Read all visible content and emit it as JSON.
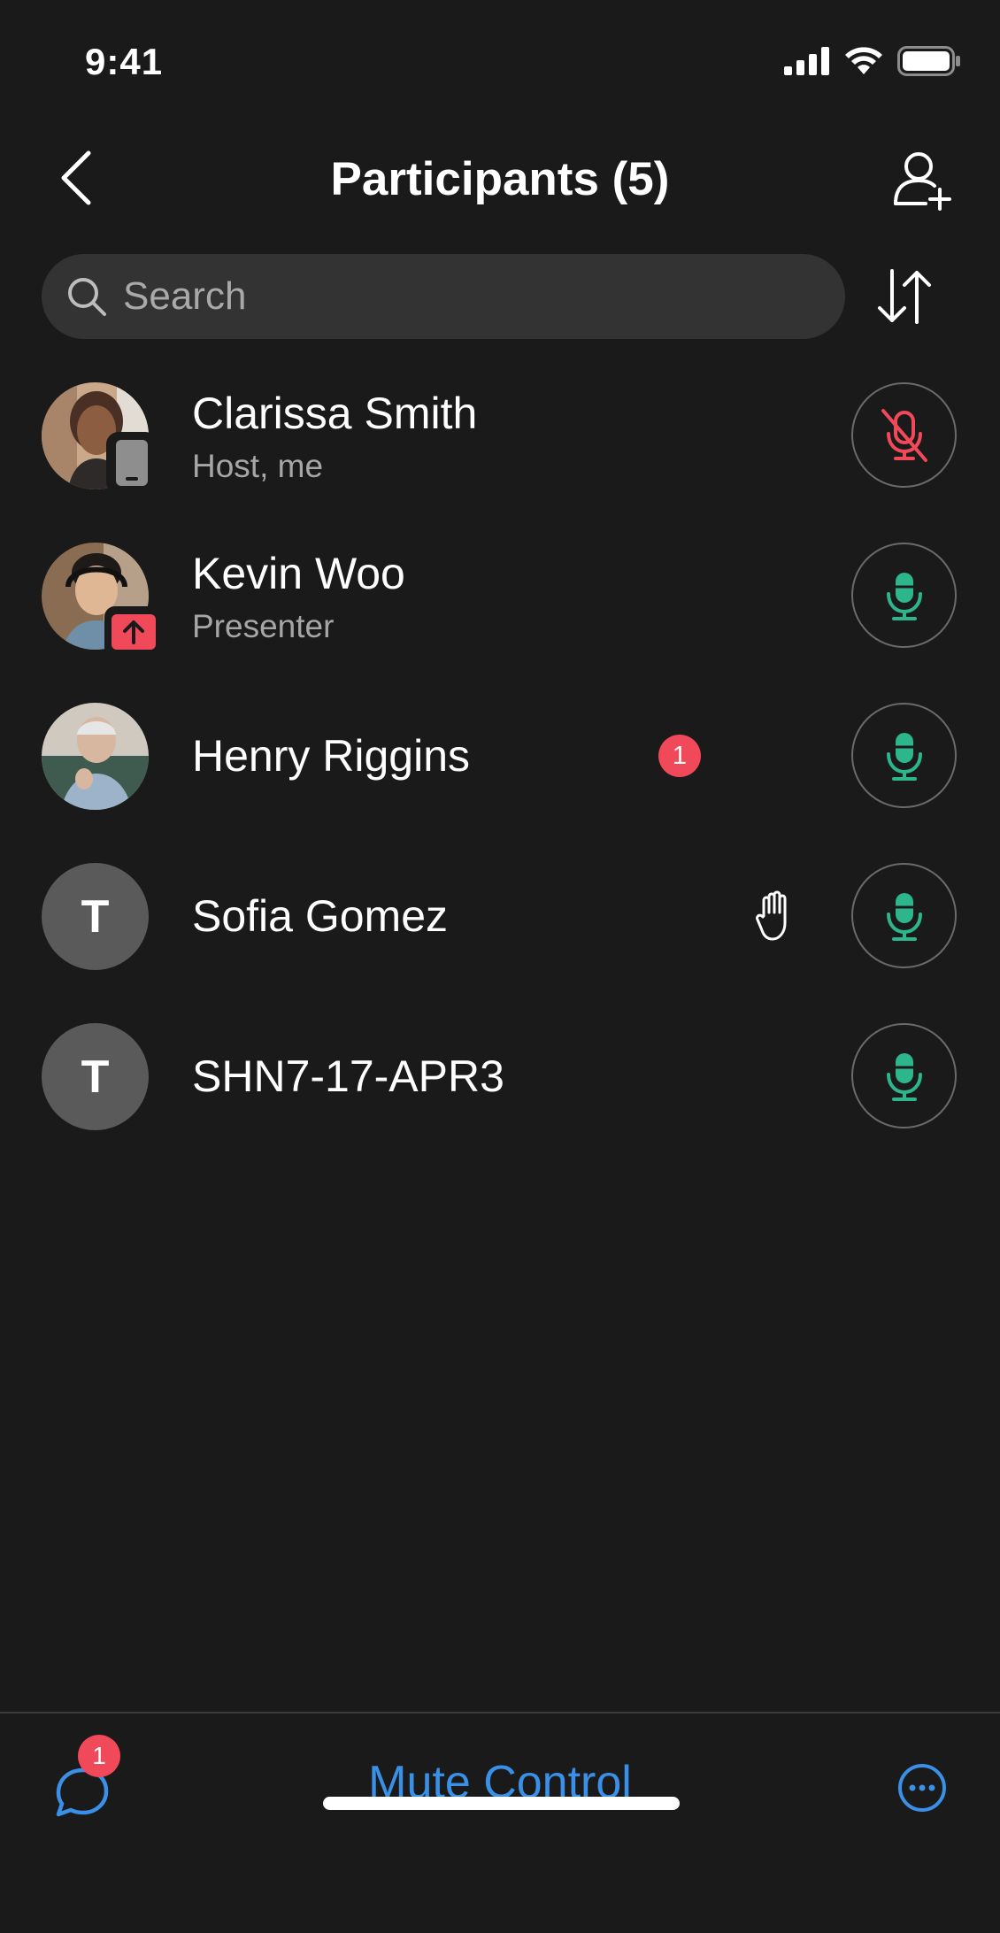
{
  "status_bar": {
    "time": "9:41"
  },
  "header": {
    "title": "Participants (5)"
  },
  "search": {
    "placeholder": "Search"
  },
  "participants": [
    {
      "name": "Clarissa Smith",
      "role": "Host, me",
      "avatar": "photo",
      "device_badge": "mobile-phone-icon",
      "mic": "muted"
    },
    {
      "name": "Kevin Woo",
      "role": "Presenter",
      "avatar": "photo",
      "device_badge": "share-screen-icon",
      "mic": "unmuted"
    },
    {
      "name": "Henry Riggins",
      "role": "",
      "avatar": "photo",
      "unread_count": "1",
      "mic": "unmuted"
    },
    {
      "name": "Sofia Gomez",
      "role": "",
      "avatar_initial": "T",
      "raised_hand": true,
      "mic": "unmuted"
    },
    {
      "name": "SHN7-17-APR3",
      "role": "",
      "avatar_initial": "T",
      "mic": "unmuted"
    }
  ],
  "bottom_bar": {
    "chat_badge": "1",
    "mute_control_label": "Mute Control"
  },
  "colors": {
    "background": "#1a1a1a",
    "accent_blue": "#3a8fe6",
    "muted_red": "#f0495a",
    "mic_green": "#2db58c"
  }
}
